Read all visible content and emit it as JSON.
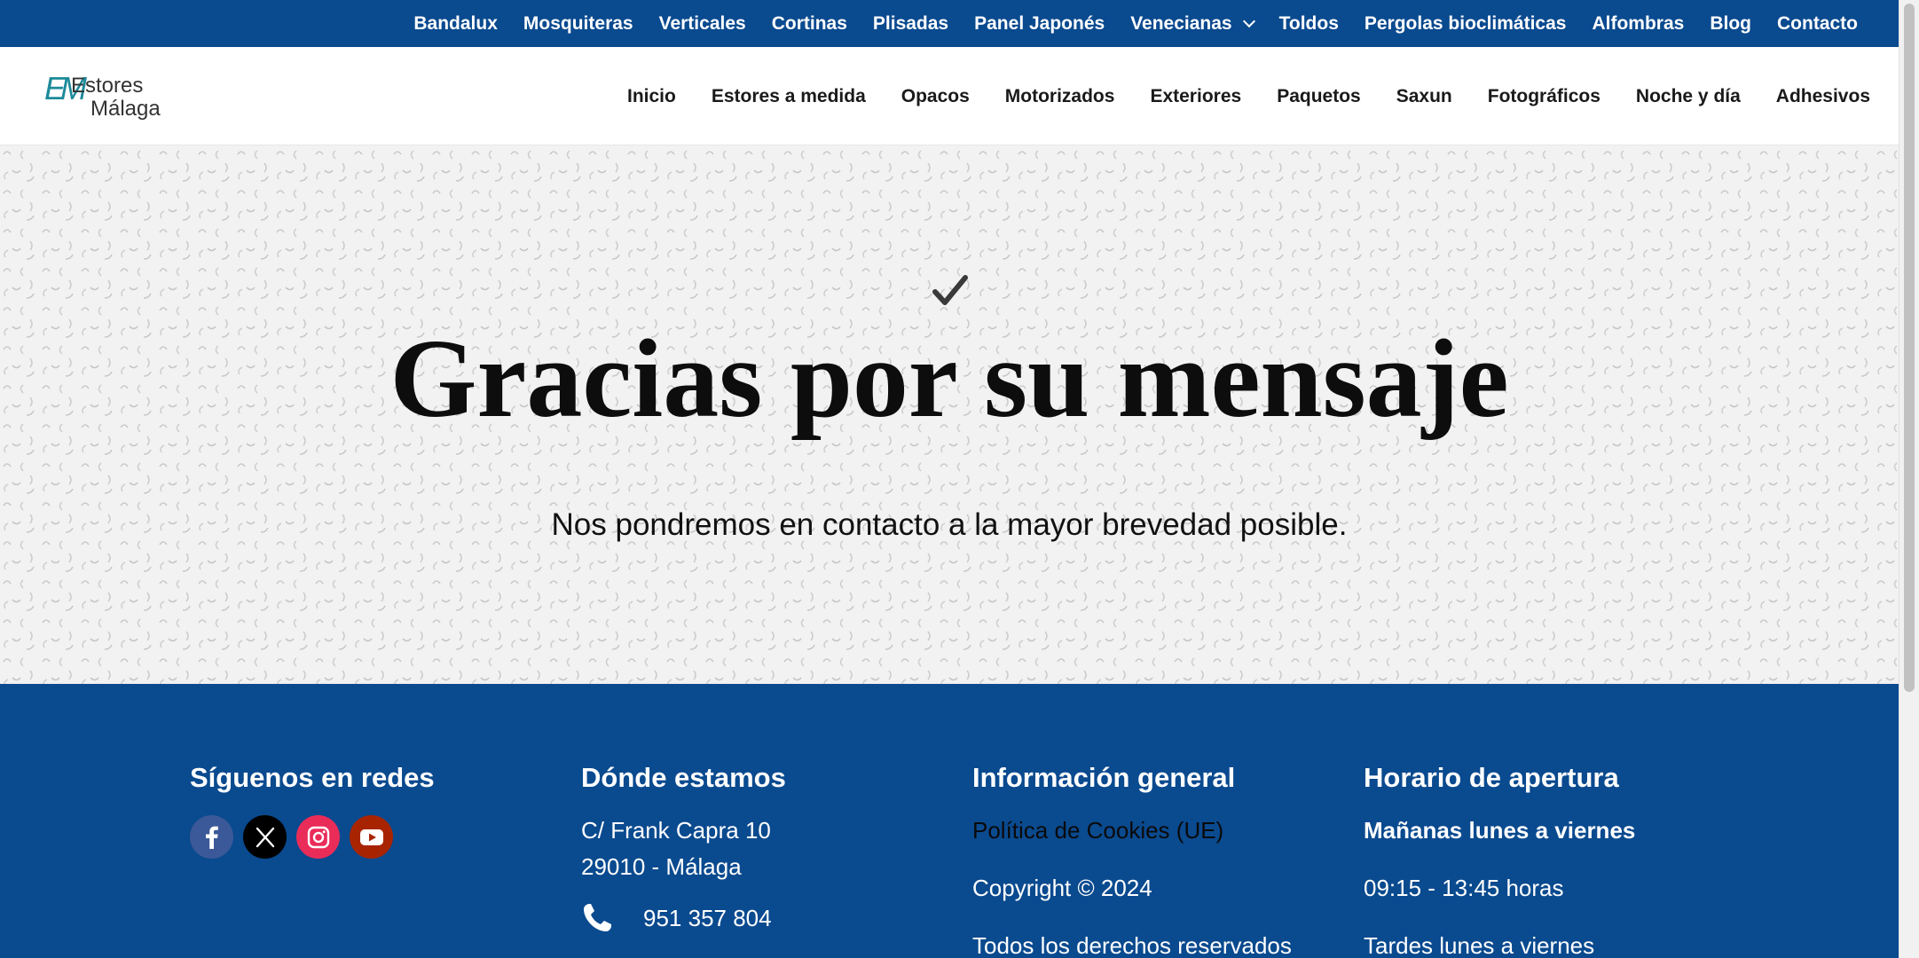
{
  "topbar": {
    "items": [
      "Bandalux",
      "Mosquiteras",
      "Verticales",
      "Cortinas",
      "Plisadas",
      "Panel Japonés",
      "Venecianas",
      "Toldos",
      "Pergolas bioclimáticas",
      "Alfombras",
      "Blog",
      "Contacto"
    ]
  },
  "logo": {
    "line1": "Estores",
    "line2": "Málaga"
  },
  "mainnav": {
    "items": [
      "Inicio",
      "Estores a medida",
      "Opacos",
      "Motorizados",
      "Exteriores",
      "Paquetos",
      "Saxun",
      "Fotográficos",
      "Noche y día",
      "Adhesivos"
    ]
  },
  "hero": {
    "title": "Gracias por su mensaje",
    "subtitle": "Nos pondremos en contacto a la mayor brevedad posible."
  },
  "footer": {
    "social": {
      "heading": "Síguenos en redes",
      "icons": [
        {
          "name": "facebook-icon",
          "color": "#3b5998"
        },
        {
          "name": "x-icon",
          "color": "#000000"
        },
        {
          "name": "instagram-icon",
          "color": "#ea2c59"
        },
        {
          "name": "youtube-icon",
          "color": "#a82400"
        }
      ]
    },
    "location": {
      "heading": "Dónde estamos",
      "address1": "C/ Frank Capra 10",
      "address2": "29010 - Málaga",
      "phone": "951 357 804"
    },
    "info": {
      "heading": "Información general",
      "cookies": "Política de Cookies (UE)",
      "copyright": "Copyright © 2024",
      "rights": "Todos los derechos reservados"
    },
    "hours": {
      "heading": "Horario de apertura",
      "morning_label": "Mañanas lunes a viernes",
      "morning_hours": "09:15 - 13:45 horas",
      "afternoon_label": "Tardes lunes a viernes"
    }
  },
  "colors": {
    "brand_blue": "#0a4a8f",
    "logo_teal": "#1d8a9a"
  }
}
